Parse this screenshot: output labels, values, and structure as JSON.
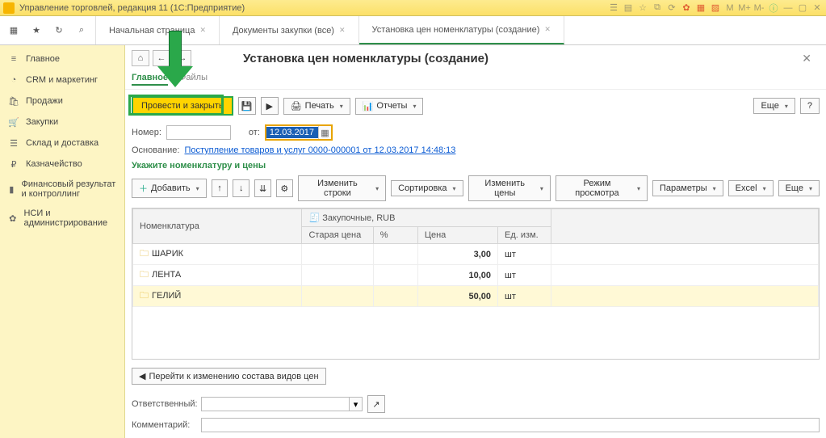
{
  "titlebar": {
    "text": "Управление торговлей, редакция 11   (1С:Предприятие)"
  },
  "toolbar_icons": {
    "apps": "▦",
    "star": "★",
    "nav": "↻",
    "search": "⌕"
  },
  "tabs": [
    {
      "label": "Начальная страница",
      "active": false
    },
    {
      "label": "Документы закупки (все)",
      "active": false
    },
    {
      "label": "Установка цен номенклатуры (создание)",
      "active": true
    }
  ],
  "sidebar": {
    "items": [
      {
        "label": "Главное",
        "icon": "≡"
      },
      {
        "label": "CRM и маркетинг",
        "icon": "◔"
      },
      {
        "label": "Продажи",
        "icon": "🛍"
      },
      {
        "label": "Закупки",
        "icon": "🛒"
      },
      {
        "label": "Склад и доставка",
        "icon": "☰"
      },
      {
        "label": "Казначейство",
        "icon": "₽"
      },
      {
        "label": "Финансовый результат и контроллинг",
        "icon": "▮"
      },
      {
        "label": "НСИ и администрирование",
        "icon": "✿"
      }
    ]
  },
  "page": {
    "title": "Установка цен номенклатуры (создание)",
    "tabs": {
      "main": "Главное",
      "files": "Файлы"
    },
    "primary_button": "Провести и закрыть",
    "print": "Печать",
    "reports": "Отчеты",
    "more": "Еще",
    "help": "?",
    "number_label": "Номер:",
    "number_value": "",
    "date_label": "от:",
    "date_value": "12.03.2017",
    "basis_label": "Основание:",
    "basis_link": "Поступление товаров и услуг 0000-000001 от 12.03.2017 14:48:13",
    "section_title": "Укажите номенклатуру и цены",
    "add_btn": "Добавить",
    "change_rows": "Изменить строки",
    "sort": "Сортировка",
    "change_prices": "Изменить цены",
    "view_mode": "Режим просмотра",
    "params": "Параметры",
    "excel": "Excel",
    "footer_btn": "Перейти к изменению состава видов цен",
    "responsible_label": "Ответственный:",
    "responsible_value": "",
    "comment_label": "Комментарий:",
    "comment_value": ""
  },
  "table": {
    "col_nomenclature": "Номенклатура",
    "col_group": "Закупочные, RUB",
    "col_old": "Старая цена",
    "col_pct": "%",
    "col_price": "Цена",
    "col_unit": "Ед. изм.",
    "rows": [
      {
        "name": "ШАРИК",
        "price": "3,00",
        "unit": "шт",
        "sel": false
      },
      {
        "name": "ЛЕНТА",
        "price": "10,00",
        "unit": "шт",
        "sel": false
      },
      {
        "name": "ГЕЛИЙ",
        "price": "50,00",
        "unit": "шт",
        "sel": true
      }
    ]
  }
}
